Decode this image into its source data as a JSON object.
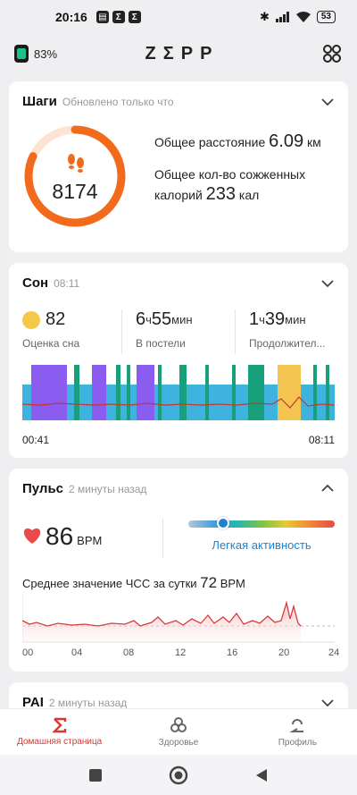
{
  "status_bar": {
    "time": "20:16",
    "battery": "53"
  },
  "header": {
    "watch_battery": "83%",
    "logo": "ZΣPP"
  },
  "steps": {
    "title": "Шаги",
    "subtitle": "Обновлено только что",
    "count": "8174",
    "goal_progress": 0.82,
    "distance_label": "Общее расстояние",
    "distance_value": "6.09",
    "distance_unit": "км",
    "calories_label_1": "Общее кол-во сожженных",
    "calories_label_2": "калорий",
    "calories_value": "233",
    "calories_unit": "кал",
    "accent": "#f26b1d"
  },
  "sleep": {
    "title": "Сон",
    "subtitle": "08:11",
    "score": "82",
    "score_label": "Оценка сна",
    "in_bed_h": "6",
    "in_bed_m": "55",
    "in_bed_label": "В постели",
    "duration_h": "1",
    "duration_m": "39",
    "duration_label": "Продолжител...",
    "hour_unit": "ч",
    "min_unit": "мин",
    "start": "00:41",
    "end": "08:11",
    "colors": {
      "light": "#3eb3e0",
      "deep": "#8a5cf0",
      "rem": "#17a07a",
      "awake": "#f5c552"
    }
  },
  "pulse": {
    "title": "Пульс",
    "subtitle": "2 минуты назад",
    "bpm": "86",
    "bpm_unit": "BPM",
    "zone_label": "Легкая активность",
    "zone_position": 0.24,
    "avg_label": "Среднее значение ЧСС за сутки",
    "avg_value": "72",
    "avg_unit": "BPM",
    "axis": [
      "00",
      "04",
      "08",
      "12",
      "16",
      "20",
      "24"
    ]
  },
  "pai": {
    "title": "PAI",
    "subtitle": "2 минуты назад"
  },
  "bottom_nav": {
    "home": "Домашняя страница",
    "health": "Здоровье",
    "profile": "Профиль"
  }
}
